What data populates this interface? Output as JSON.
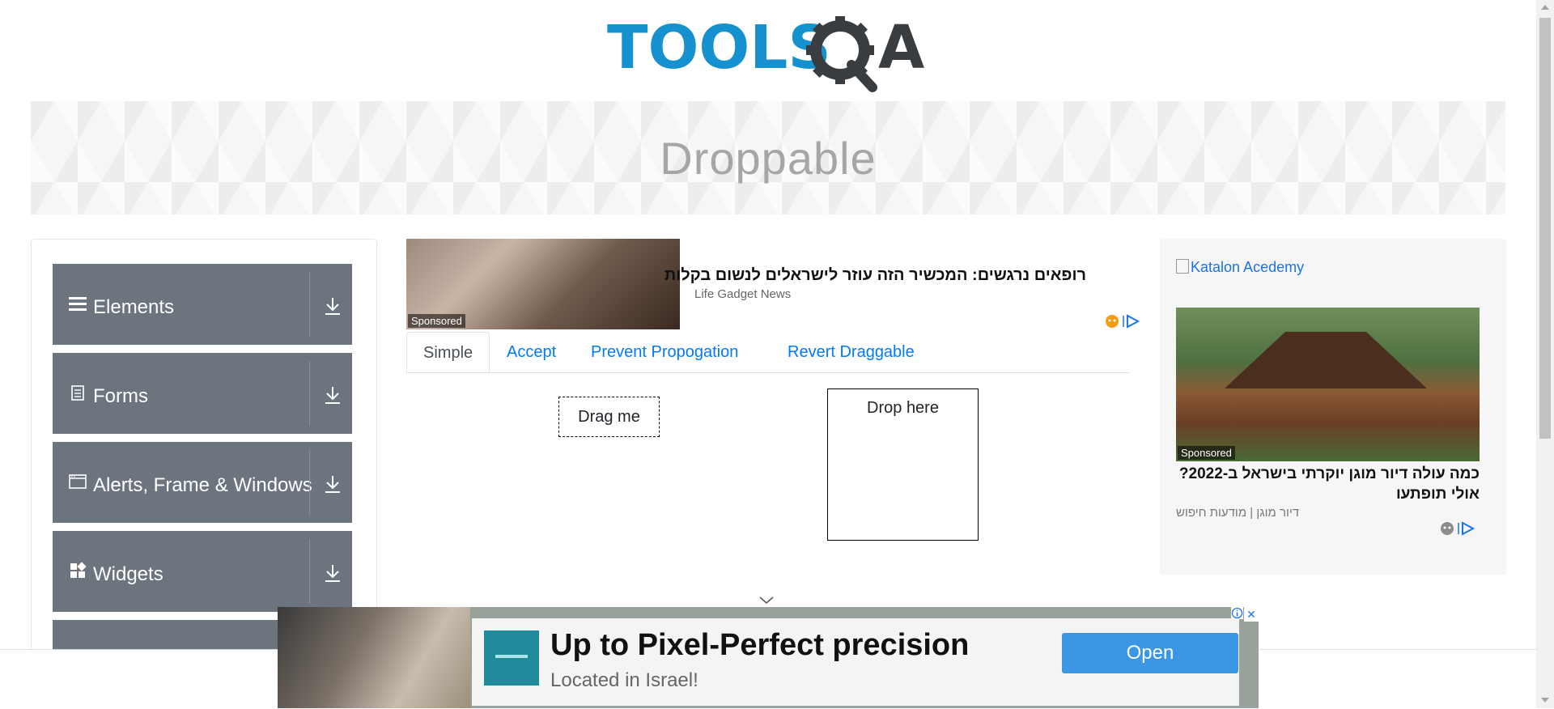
{
  "header": {
    "logo_text_left": "TOOLS",
    "logo_text_right": "A"
  },
  "banner": {
    "title": "Droppable"
  },
  "sidebar": {
    "groups": [
      {
        "label": "Elements",
        "icon": "menu-lines-icon"
      },
      {
        "label": "Forms",
        "icon": "document-icon"
      },
      {
        "label": "Alerts, Frame & Windows",
        "icon": "window-icon"
      },
      {
        "label": "Widgets",
        "icon": "widgets-grid-icon"
      }
    ]
  },
  "ad_top": {
    "sponsored": "Sponsored",
    "headline": "רופאים נרגשים: המכשיר הזה עוזר לישראלים לנשום בקלות",
    "source": "Life Gadget News"
  },
  "tabs": [
    {
      "label": "Simple",
      "active": true
    },
    {
      "label": "Accept",
      "active": false
    },
    {
      "label": "Prevent Propogation",
      "active": false
    },
    {
      "label": "Revert Draggable",
      "active": false
    }
  ],
  "draggable": {
    "label": "Drag me"
  },
  "droppable": {
    "label": "Drop here"
  },
  "ad_right": {
    "image_alt": "Katalon Acedemy",
    "sponsored": "Sponsored",
    "headline": "כמה עולה דיור מוגן יוקרתי בישראל ב-2022? אולי תופתעו",
    "source": "דיור מוגן | מודעות חיפוש"
  },
  "ad_bottom": {
    "title": "Up to Pixel-Perfect precision",
    "subtitle": "Located in Israel!",
    "button": "Open",
    "close": "✕"
  },
  "colors": {
    "brand_blue": "#1591d0",
    "brand_dark": "#3a3d40",
    "sidebar_group": "#6c757d",
    "link": "#007bff",
    "ad_button": "#3b97e3"
  }
}
